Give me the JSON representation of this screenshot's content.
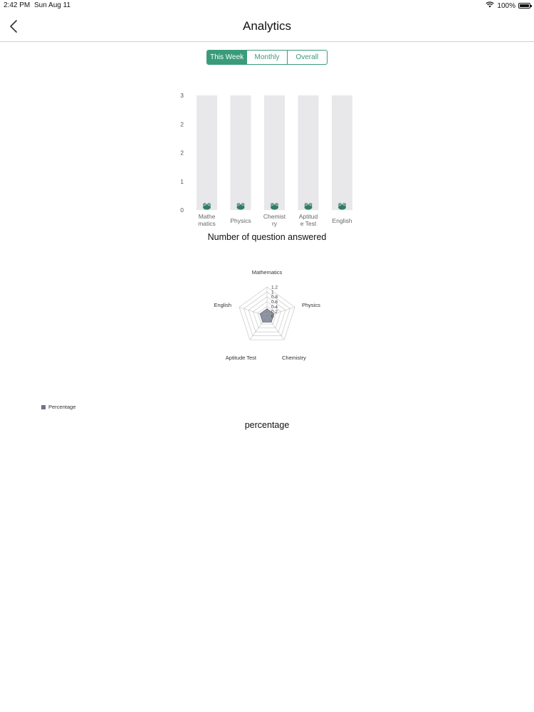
{
  "status_bar": {
    "time": "2:42 PM",
    "date": "Sun Aug 11",
    "battery": "100%"
  },
  "nav": {
    "title": "Analytics"
  },
  "segments": [
    {
      "label": "This Week",
      "active": true
    },
    {
      "label": "Monthly",
      "active": false
    },
    {
      "label": "Overall",
      "active": false
    }
  ],
  "colors": {
    "accent": "#3a9b7b",
    "bar_track": "#e8e7ea",
    "radar_fill": "#6e7584",
    "grid": "#c8c8c8"
  },
  "chart_data": [
    {
      "type": "bar",
      "title": "Number of question answered",
      "categories": [
        [
          "Mathe",
          "matics"
        ],
        [
          "Physics"
        ],
        [
          "Chemist",
          "ry"
        ],
        [
          "Aptitud",
          "e Test"
        ],
        [
          "English"
        ]
      ],
      "values": [
        0,
        0,
        0,
        0,
        0
      ],
      "ytick_labels": [
        "0",
        "1",
        "2",
        "2",
        "3"
      ],
      "ylim": [
        0,
        3
      ],
      "marker_icon": "frog-icon"
    },
    {
      "type": "radar",
      "title": "percentage",
      "axes": [
        "Mathematics",
        "Physics",
        "Chemistry",
        "Aptitude Test",
        "English"
      ],
      "series": [
        {
          "name": "Percentage",
          "values": [
            0.3,
            0.3,
            0.3,
            0.3,
            0.3
          ]
        }
      ],
      "rtick_labels": [
        "0",
        "0.2",
        "0.4",
        "0.6",
        "0.8",
        "1",
        "1.2"
      ],
      "rlim": [
        0,
        1.2
      ],
      "legend": "bottom-left"
    }
  ]
}
